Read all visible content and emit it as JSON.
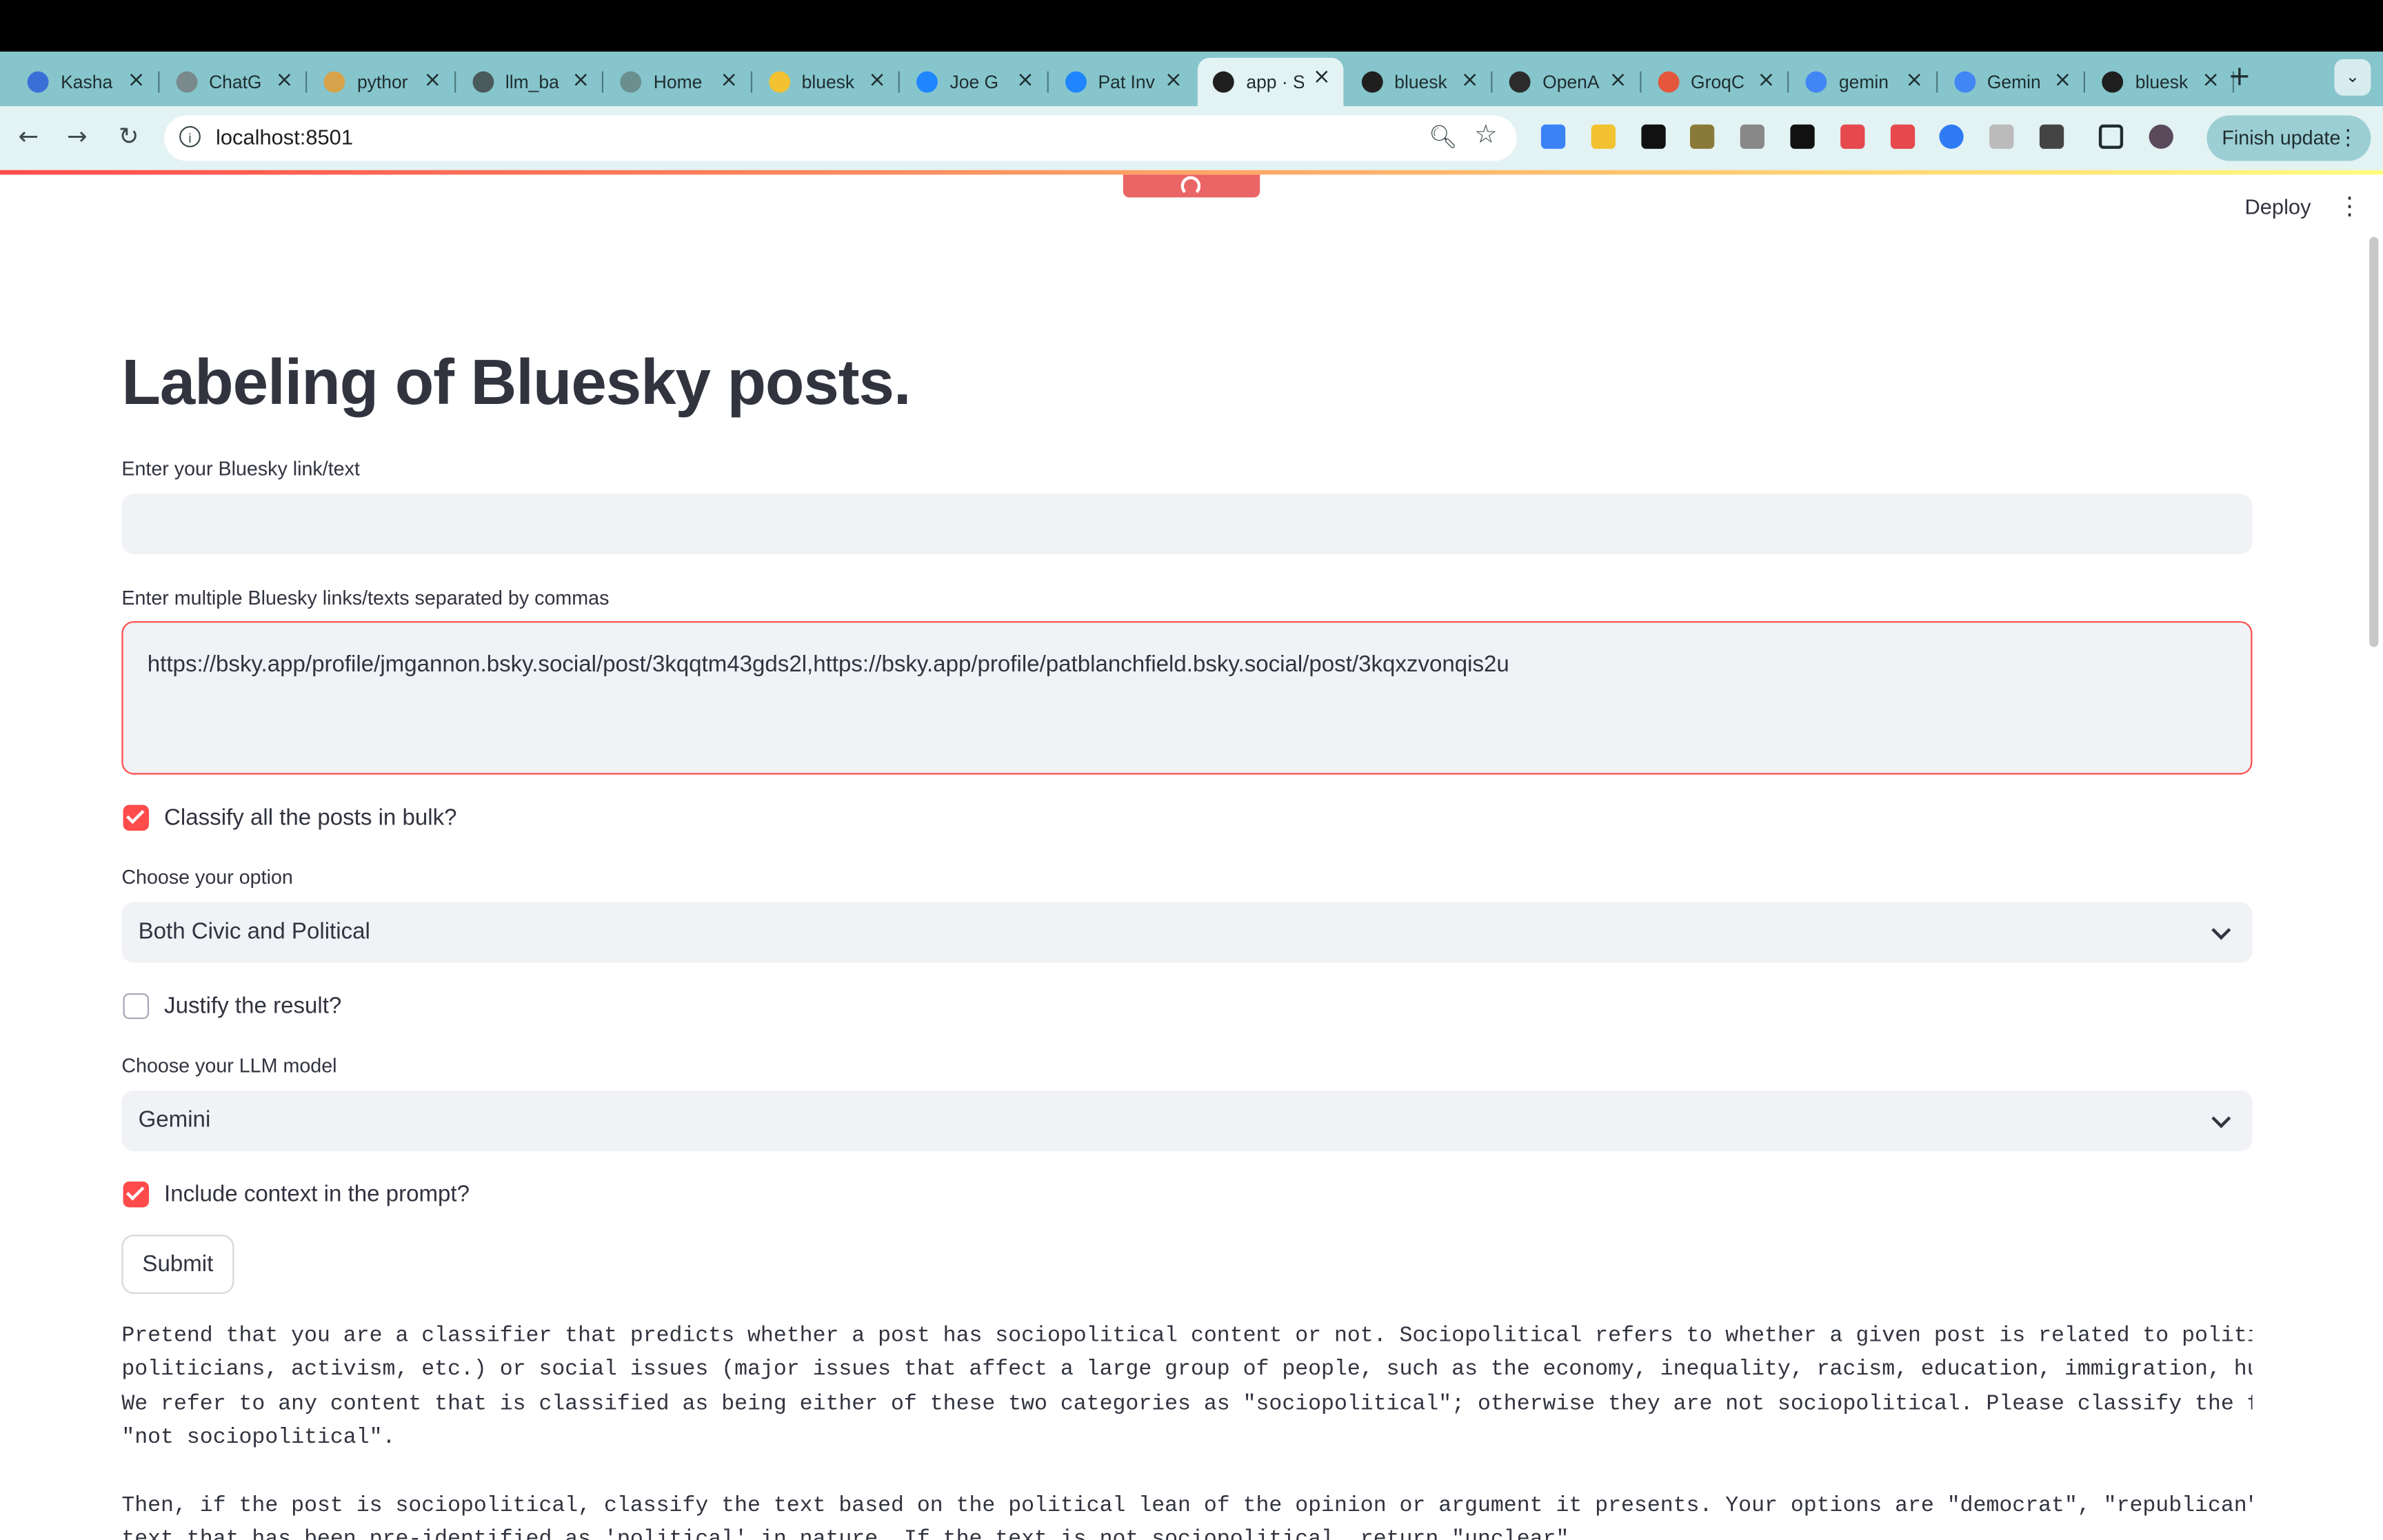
{
  "browser": {
    "tabs": [
      {
        "label": "Kasha",
        "color": "#3b6fd8"
      },
      {
        "label": "ChatG",
        "color": "#7a8a8c"
      },
      {
        "label": "pythor",
        "color": "#d8a24a"
      },
      {
        "label": "llm_ba",
        "color": "#4a5a5c"
      },
      {
        "label": "Home",
        "color": "#6b8e8f"
      },
      {
        "label": "bluesk",
        "color": "#f2c230"
      },
      {
        "label": "Joe G",
        "color": "#1f86ff"
      },
      {
        "label": "Pat Inv",
        "color": "#1f86ff"
      },
      {
        "label": "app · S",
        "color": "#1f1f1f"
      },
      {
        "label": "bluesk",
        "color": "#1f1f1f"
      },
      {
        "label": "OpenA",
        "color": "#2b2b2b"
      },
      {
        "label": "GroqC",
        "color": "#e5573d"
      },
      {
        "label": "gemin",
        "color": "#4285f4"
      },
      {
        "label": "Gemin",
        "color": "#4285f4"
      },
      {
        "label": "bluesk",
        "color": "#1f1f1f"
      }
    ],
    "active_tab_index": 8,
    "new_tab_glyph": "+",
    "tab_menu_glyph": "⌄",
    "url": "localhost:8501",
    "finish_update_label": "Finish update",
    "extension_colors": [
      "#3b82f6",
      "#f2c230",
      "#111111",
      "#8a7a3a",
      "#888888",
      "#111111",
      "#e5484d",
      "#e5484d",
      "#2f7bf6",
      "#bbbbbb",
      "#444444"
    ]
  },
  "app": {
    "deploy_label": "Deploy",
    "title": "Labeling of Bluesky posts.",
    "single_input": {
      "label": "Enter your Bluesky link/text",
      "value": ""
    },
    "multi_input": {
      "label": "Enter multiple Bluesky links/texts separated by commas",
      "value": "https://bsky.app/profile/jmgannon.bsky.social/post/3kqqtm43gds2l,https://bsky.app/profile/patblanchfield.bsky.social/post/3kqxzvonqis2u"
    },
    "bulk_checkbox": {
      "label": "Classify all the posts in bulk?",
      "checked": true
    },
    "option_select": {
      "label": "Choose your option",
      "value": "Both Civic and Political"
    },
    "justify_checkbox": {
      "label": "Justify the result?",
      "checked": false
    },
    "model_select": {
      "label": "Choose your LLM model",
      "value": "Gemini"
    },
    "context_checkbox": {
      "label": "Include context in the prompt?",
      "checked": true
    },
    "submit_label": "Submit",
    "prompt_paragraph_1": "Pretend that you are a classifier that predicts whether a post has sociopolitical content or not. Sociopolitical refers to whether a given post is related to politics\npoliticians, activism, etc.) or social issues (major issues that affect a large group of people, such as the economy, inequality, racism, education, immigration, human\nWe refer to any content that is classified as being either of these two categories as \"sociopolitical\"; otherwise they are not sociopolitical. Please classify the foll\n\"not sociopolitical\".",
    "prompt_paragraph_2": "Then, if the post is sociopolitical, classify the text based on the political lean of the opinion or argument it presents. Your options are \"democrat\", \"republican\", o\ntext that has been pre-identified as 'political' in nature. If the text is not sociopolitical, return \"unclear\"."
  }
}
